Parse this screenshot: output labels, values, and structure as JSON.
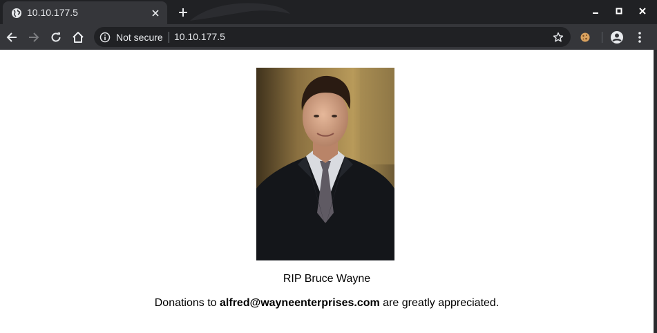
{
  "browser": {
    "tab": {
      "title": "10.10.177.5",
      "favicon": "globe-icon",
      "close_icon": "close-icon"
    },
    "new_tab_icon": "plus-icon",
    "window_controls": [
      "minimize-icon",
      "maximize-icon",
      "close-window-icon"
    ],
    "toolbar": {
      "back_icon": "arrow-left-icon",
      "forward_icon": "arrow-right-icon",
      "reload_icon": "reload-icon",
      "home_icon": "home-icon",
      "security_icon": "info-circle-icon",
      "security_label": "Not secure",
      "url": "10.10.177.5",
      "bookmark_icon": "star-icon",
      "extension_icon": "cookie-icon",
      "profile_icon": "account-icon",
      "menu_icon": "kebab-menu-icon"
    },
    "colors": {
      "tabstrip": "#202124",
      "toolbar": "#35363a",
      "omnibox": "#202124",
      "text": "#e8eaed"
    }
  },
  "page": {
    "image_alt": "portrait of a man in a dark suit and tie",
    "caption": "RIP Bruce Wayne",
    "donation": {
      "prefix": "Donations to ",
      "email": "alfred@wayneenterprises.com",
      "suffix": " are greatly appreciated."
    }
  }
}
